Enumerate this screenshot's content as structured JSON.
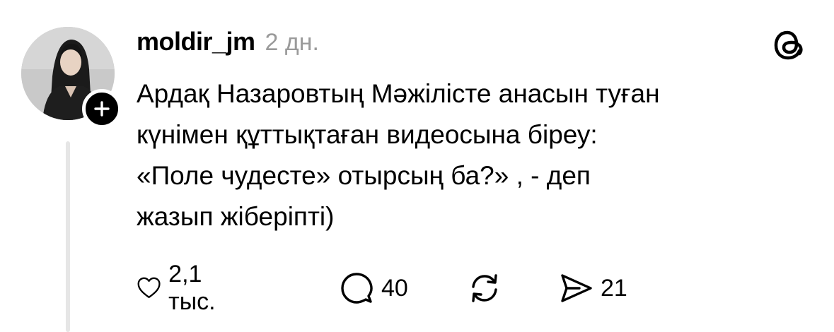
{
  "post": {
    "username": "moldir_jm",
    "timestamp": "2 дн.",
    "text_lines": [
      "Ардақ Назаровтың Мәжілісте анасын туған",
      "күнімен құттықтаған видеосына біреу:",
      "«Поле чудесте» отырсың ба?» , - деп",
      "жазып жіберіпті)"
    ]
  },
  "actions": {
    "like": {
      "icon": "heart-icon",
      "count": "2,1 тыс."
    },
    "reply": {
      "icon": "comment-icon",
      "count": "40"
    },
    "repost": {
      "icon": "repost-icon",
      "count": ""
    },
    "share": {
      "icon": "send-icon",
      "count": "21"
    }
  },
  "colors": {
    "text": "#000000",
    "muted": "#9a9a9a",
    "thread_line": "#e6e6e6",
    "background": "#ffffff"
  }
}
